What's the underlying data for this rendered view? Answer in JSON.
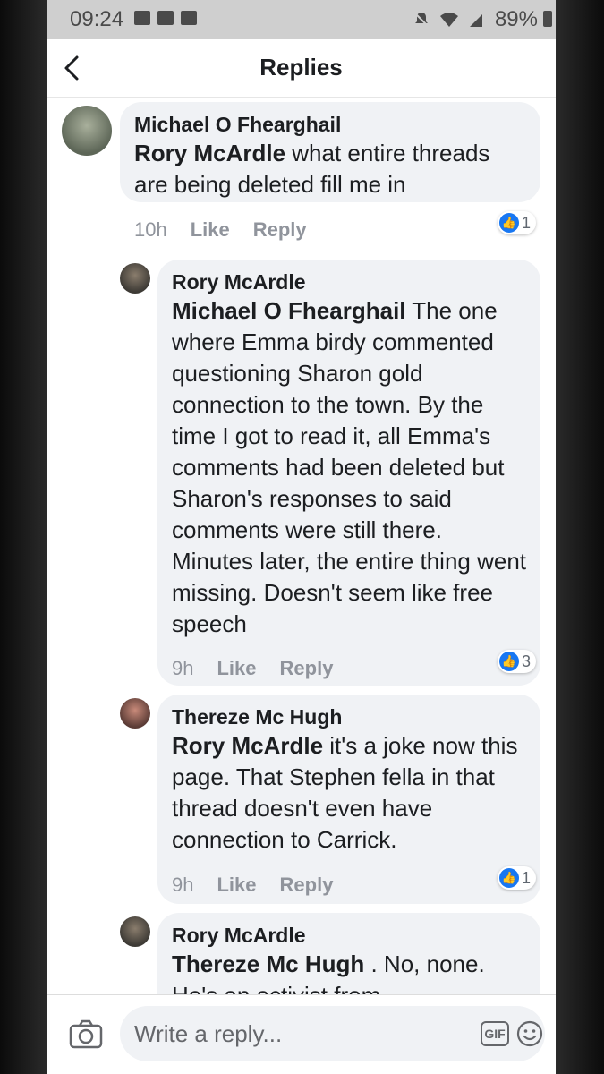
{
  "status_bar": {
    "time": "09:24",
    "battery": "89%"
  },
  "header": {
    "title": "Replies"
  },
  "comments": [
    {
      "author": "Michael O Fhearghail",
      "mention": "Rory McArdle",
      "text": " what entire threads are being deleted fill me in",
      "time": "10h",
      "like_label": "Like",
      "reply_label": "Reply",
      "reaction_count": "1"
    },
    {
      "author": "Rory McArdle",
      "mention": "Michael O Fhearghail",
      "text": " The one where Emma birdy commented questioning Sharon gold connection to the town. By the time I got to read it, all Emma's comments had been deleted but Sharon's responses to said comments were still there. Minutes later, the entire thing went missing. Doesn't seem like free speech",
      "time": "9h",
      "like_label": "Like",
      "reply_label": "Reply",
      "reaction_count": "3"
    },
    {
      "author": "Thereze Mc Hugh",
      "mention": "Rory McArdle",
      "text": " it's a joke now this page. That Stephen fella in that thread doesn't even have connection to Carrick.",
      "time": "9h",
      "like_label": "Like",
      "reply_label": "Reply",
      "reaction_count": "1"
    },
    {
      "author": "Rory McArdle",
      "mention": "Thereze Mc Hugh",
      "text": " . No, none. He's an activist from",
      "time": "",
      "like_label": "",
      "reply_label": "",
      "reaction_count": ""
    }
  ],
  "composer": {
    "placeholder": "Write a reply...",
    "gif_label": "GIF"
  },
  "colors": {
    "accent": "#1877f2",
    "bubble": "#f0f2f5",
    "meta": "#90949c"
  }
}
